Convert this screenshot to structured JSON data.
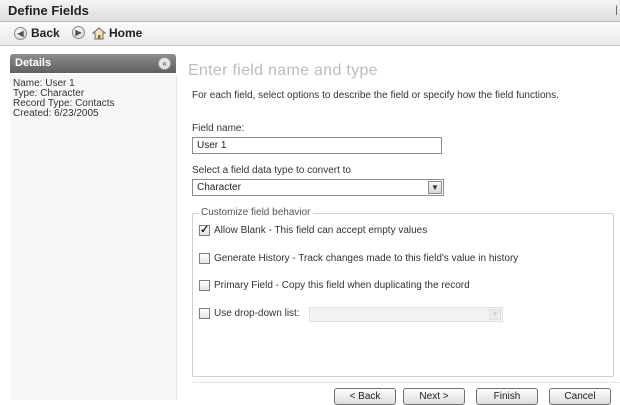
{
  "window": {
    "title": "Define Fields"
  },
  "nav": {
    "back_label": "Back",
    "home_label": "Home"
  },
  "details": {
    "header": "Details",
    "lines": [
      "Name: User 1",
      "Type: Character",
      "Record Type: Contacts",
      "Created: 6/23/2005"
    ]
  },
  "main": {
    "heading": "Enter field name and type",
    "instructions": "For each field, select options to describe the field or specify how the field functions.",
    "field_name_label": "Field name:",
    "field_name_value": "User 1",
    "data_type_label": "Select a field data type to convert to",
    "data_type_value": "Character",
    "group_label": "Customize field behavior",
    "options": [
      {
        "label": "Allow Blank - This field can accept empty values",
        "checked": true
      },
      {
        "label": "Generate History - Track changes made to this field's value in history",
        "checked": false
      },
      {
        "label": "Primary Field - Copy this field when duplicating the record",
        "checked": false
      },
      {
        "label": "Use drop-down list:",
        "checked": false
      }
    ]
  },
  "buttons": {
    "back": "< Back",
    "next": "Next >",
    "finish": "Finish",
    "cancel": "Cancel"
  }
}
